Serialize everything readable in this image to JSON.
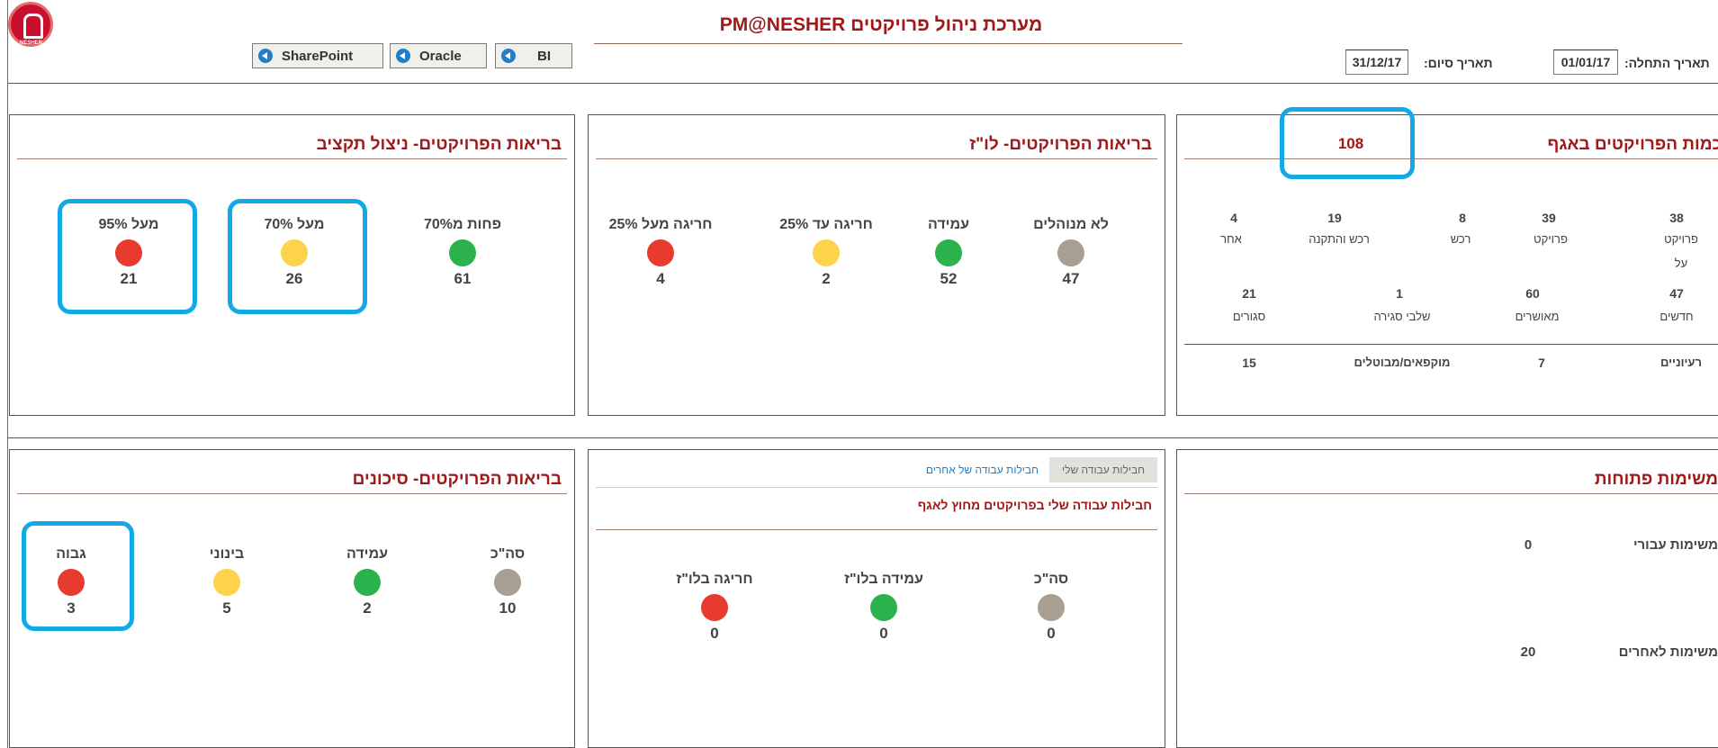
{
  "header": {
    "logo_text": "NESHER",
    "title": "PM@NESHER מערכת ניהול פרויקטים",
    "nav": [
      {
        "label": "SharePoint",
        "icon": "back-arrow-icon"
      },
      {
        "label": "Oracle",
        "icon": "back-arrow-icon"
      },
      {
        "label": "BI",
        "icon": "back-arrow-icon"
      }
    ],
    "start_label": "תאריך התחלה:",
    "start_value": "01/01/17",
    "end_label": "תאריך סיום:",
    "end_value": "31/12/17"
  },
  "colors": {
    "red": "#e63b2e",
    "yellow": "#fdd34b",
    "green": "#2bb24c",
    "gray": "#a89e91",
    "highlight": "#13a8e6",
    "title": "#a01818"
  },
  "budget": {
    "title": "בריאות הפרויקטים- ניצול תקציב",
    "items": [
      {
        "label": "מעל 95%",
        "color": "red",
        "value": "21"
      },
      {
        "label": "מעל 70%",
        "color": "yellow",
        "value": "26"
      },
      {
        "label": "פחות מ70%",
        "color": "green",
        "value": "61"
      }
    ]
  },
  "schedule": {
    "title": "בריאות הפרויקטים- לו\"ז",
    "items": [
      {
        "label": "חריגה מעל 25%",
        "color": "red",
        "value": "4"
      },
      {
        "label": "חריגה עד 25%",
        "color": "yellow",
        "value": "2"
      },
      {
        "label": "עמידה",
        "color": "green",
        "value": "52"
      },
      {
        "label": "לא מנוהלים",
        "color": "gray",
        "value": "47"
      }
    ]
  },
  "count": {
    "title": "כמות הפרויקטים באגף",
    "total": "108",
    "row1_values": [
      "4",
      "19",
      "8",
      "39",
      "38"
    ],
    "row1_labels": [
      "אחר",
      "רכש והתקנה",
      "רכש",
      "פרויקט",
      "פרויקט"
    ],
    "row1_extra": "על",
    "row2_values": [
      "21",
      "1",
      "60",
      "47"
    ],
    "row2_labels": [
      "סגורים",
      "שלבי סגירה",
      "מאושרים",
      "חדשים"
    ],
    "row3": [
      "15",
      "מוקפאים/מבוטלים",
      "7",
      "רעיוניים"
    ]
  },
  "risks": {
    "title": "בריאות הפרויקטים- סיכונים",
    "items": [
      {
        "label": "גבוה",
        "color": "red",
        "value": "3"
      },
      {
        "label": "בינוני",
        "color": "yellow",
        "value": "5"
      },
      {
        "label": "עמידה",
        "color": "green",
        "value": "2"
      },
      {
        "label": "סה\"כ",
        "color": "gray",
        "value": "10"
      }
    ]
  },
  "workpackages": {
    "tab_mine": "חבילות עבודה שלי",
    "tab_others": "חבילות עבודה של אחרים",
    "subtitle": "חבילות עבודה שלי בפרויקטים מחוץ לאגף",
    "items": [
      {
        "label": "חריגה בלו\"ז",
        "color": "red",
        "value": "0"
      },
      {
        "label": "עמידה בלו\"ז",
        "color": "green",
        "value": "0"
      },
      {
        "label": "סה\"כ",
        "color": "gray",
        "value": "0"
      }
    ]
  },
  "tasks": {
    "title": "משימות פתוחות",
    "rows": [
      {
        "label": "משימות עבורי",
        "value": "0"
      },
      {
        "label": "משימות לאחרים",
        "value": "20"
      }
    ]
  }
}
